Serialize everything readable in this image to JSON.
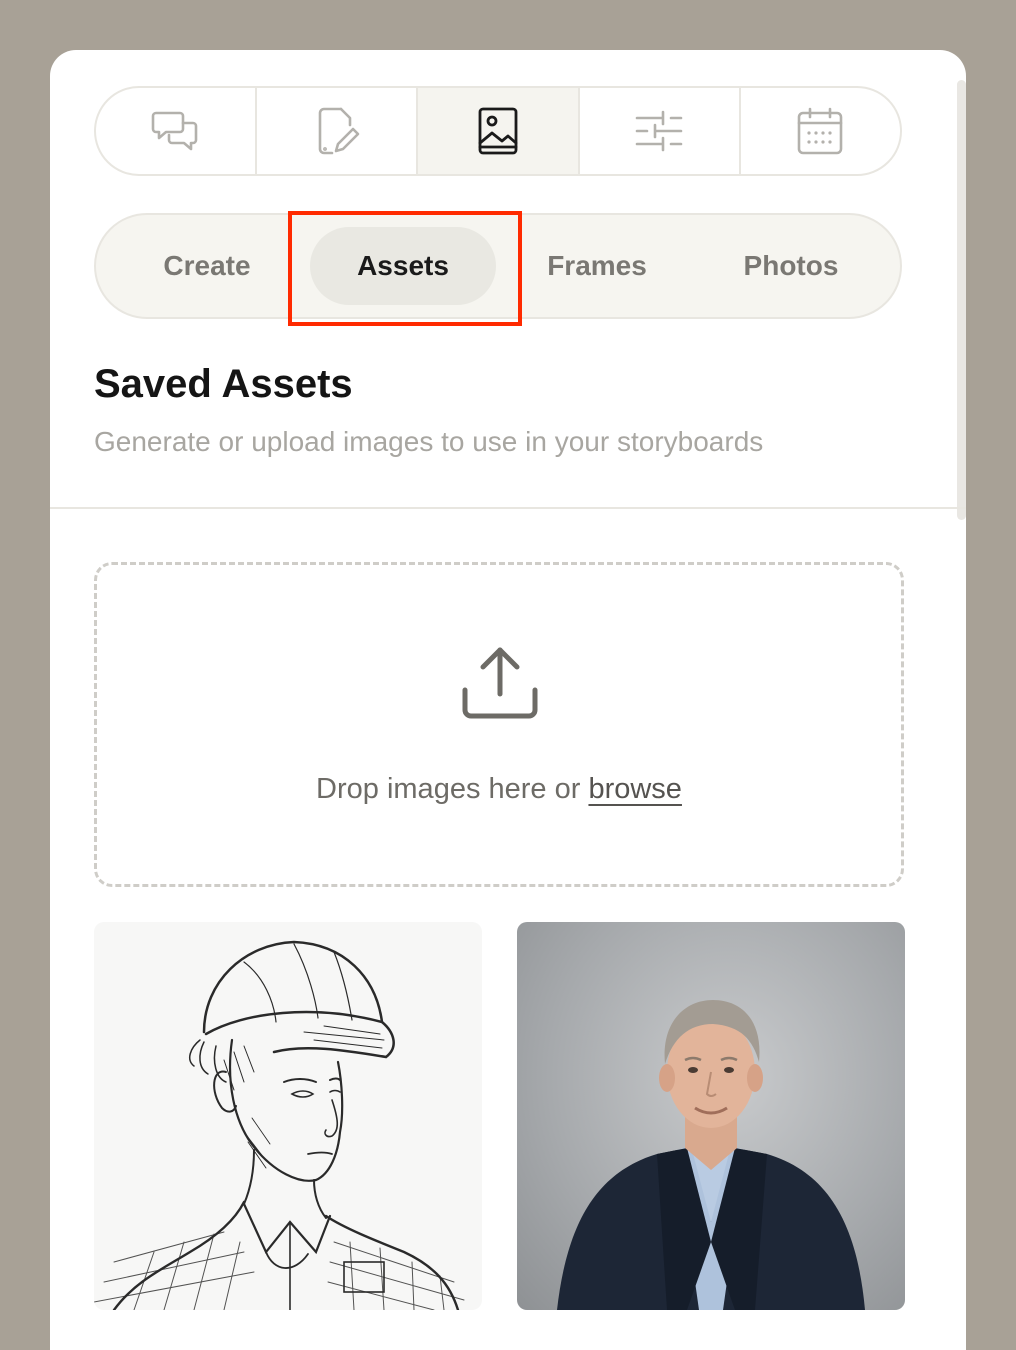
{
  "toolbar": {
    "icons": [
      {
        "name": "chat-icon",
        "active": false
      },
      {
        "name": "document-edit-icon",
        "active": false
      },
      {
        "name": "image-icon",
        "active": true
      },
      {
        "name": "sliders-icon",
        "active": false
      },
      {
        "name": "calendar-icon",
        "active": false
      }
    ]
  },
  "tabs": {
    "create": "Create",
    "assets": "Assets",
    "frames": "Frames",
    "photos": "Photos",
    "active": "Assets"
  },
  "section": {
    "title": "Saved Assets",
    "subtitle": "Generate or upload images to use in your storyboards"
  },
  "dropzone": {
    "text": "Drop images here or ",
    "link": "browse",
    "icon": "upload-icon"
  },
  "assets": [
    {
      "kind": "pencil sketch of young person in cap and plaid shirt"
    },
    {
      "kind": "portrait photo of man in dark suit"
    }
  ],
  "colors": {
    "background": "#a8a196",
    "highlight": "#ff2a00",
    "active_tab": "#e9e8e2"
  }
}
